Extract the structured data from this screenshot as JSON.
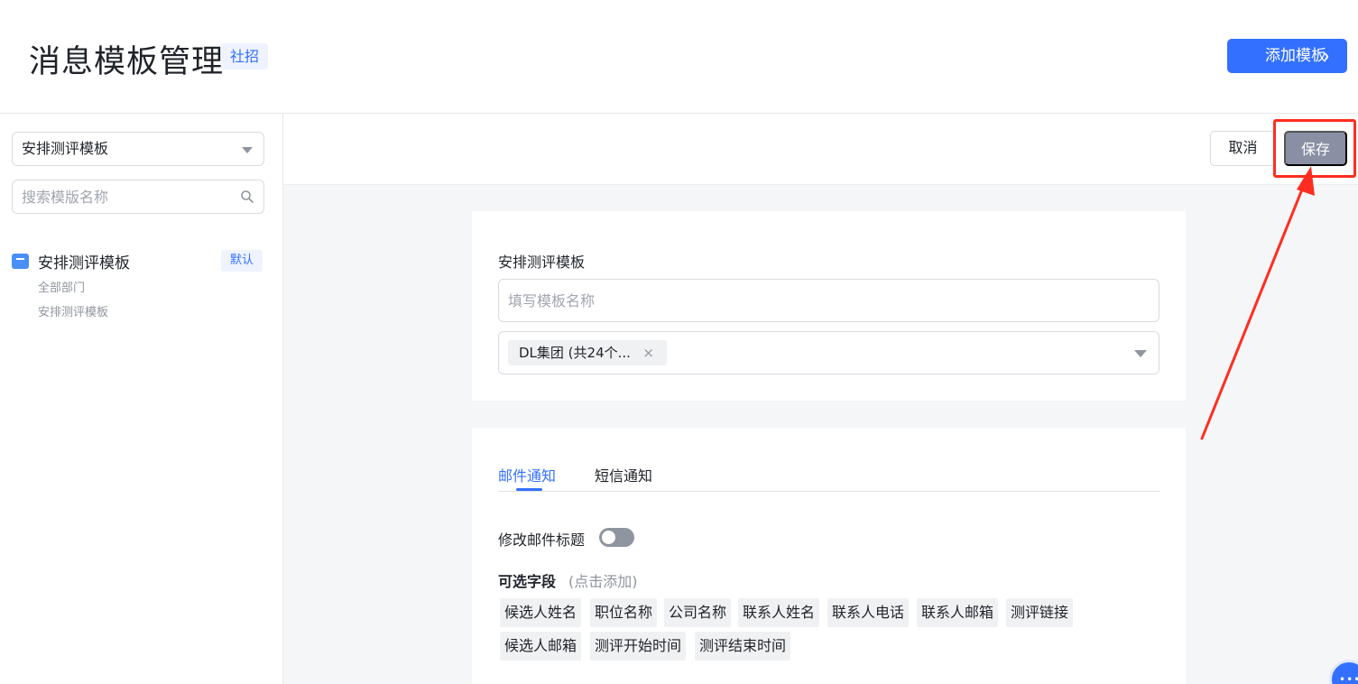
{
  "header": {
    "title": "消息模板管理",
    "badge": "社招",
    "add_button": "添加模板",
    "add_button_icon": "chevron-right-icon"
  },
  "sidebar": {
    "template_type_select": "安排测评模板",
    "search_placeholder": "搜索模版名称",
    "items": [
      {
        "name": "安排测评模板",
        "badge": "默认",
        "department": "全部部门",
        "type": "安排测评模板"
      }
    ]
  },
  "toolbar": {
    "cancel_label": "取消",
    "save_label": "保存"
  },
  "form": {
    "section_label": "安排测评模板",
    "name_placeholder": "填写模板名称",
    "dept_tag": "DL集团 (共24个...",
    "dept_tag_remove": "×"
  },
  "notify": {
    "tabs": [
      "邮件通知",
      "短信通知"
    ],
    "active_tab": 0,
    "edit_subject_label": "修改邮件标题",
    "edit_subject_on": false,
    "fields_title": "可选字段",
    "fields_hint": "(点击添加)",
    "fields_row1": [
      "候选人姓名",
      "职位名称",
      "公司名称",
      "联系人姓名",
      "联系人电话",
      "联系人邮箱",
      "测评链接"
    ],
    "fields_row2": [
      "候选人邮箱",
      "测评开始时间",
      "测评结束时间"
    ]
  },
  "colors": {
    "accent": "#3370ff",
    "save_disabled": "#8a8fa3",
    "annotation": "#ff2d20"
  }
}
